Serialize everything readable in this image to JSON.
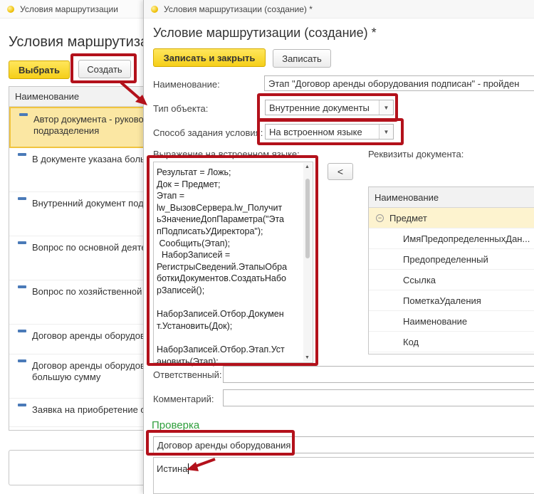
{
  "background_window": {
    "title": "Условия маршрутизации",
    "heading": "Условия маршрутизац",
    "select_button": "Выбрать",
    "create_button": "Создать",
    "table_header": "Наименование",
    "rows": [
      "Автор документа - руково\nподразделения",
      "В документе указана больш",
      "Внутренний документ под",
      "Вопрос по основной деяте",
      "Вопрос по хозяйственной",
      "Договор аренды оборудов",
      "Договор аренды оборудов\nбольшую сумму",
      "Заявка на приобретение о"
    ]
  },
  "form": {
    "window_title": "Условия маршрутизации (создание) *",
    "heading": "Условие маршрутизации (создание) *",
    "save_close_button": "Записать и закрыть",
    "save_button": "Записать",
    "name_label": "Наименование:",
    "name_value": "Этап \"Договор аренды оборудования подписан\" - пройден",
    "object_type_label": "Тип объекта:",
    "object_type_value": "Внутренние документы",
    "method_label": "Способ задания условия:",
    "method_value": "На встроенном языке",
    "expression_label": "Выражение на встроенном языке:",
    "expression_code": "Результат = Ложь;\nДок = Предмет;\nЭтап =\nlw_ВызовСервера.lw_Получит\nьЗначениеДопПараметра(\"Эта\nпПодписатьУДиректора\");\n Сообщить(Этап);\n  НаборЗаписей =\nРегистрыСведений.ЭтапыОбра\nботкиДокументов.СоздатьНабо\nрЗаписей();\n\nНаборЗаписей.Отбор.Докумен\nт.Установить(Док);\n\nНаборЗаписей.Отбор.Этап.Уст\nановить(Этап);",
    "insert_button": "<",
    "requisites_label": "Реквизиты документа:",
    "requisites_header": "Наименование",
    "requisites_group": "Предмет",
    "requisites": [
      "ИмяПредопределенныхДан...",
      "Предопределенный",
      "Ссылка",
      "ПометкаУдаления",
      "Наименование",
      "Код"
    ],
    "responsible_label": "Ответственный:",
    "responsible_value": "",
    "comment_label": "Комментарий:",
    "comment_value": "",
    "check_title": "Проверка",
    "check_object": "Договор аренды оборудования",
    "check_result": "Истина"
  },
  "colors": {
    "accent_yellow": "#f5cf19",
    "highlight_red": "#b3111b",
    "check_green": "#2e9e3b",
    "selected_row": "#fbe7a3"
  }
}
